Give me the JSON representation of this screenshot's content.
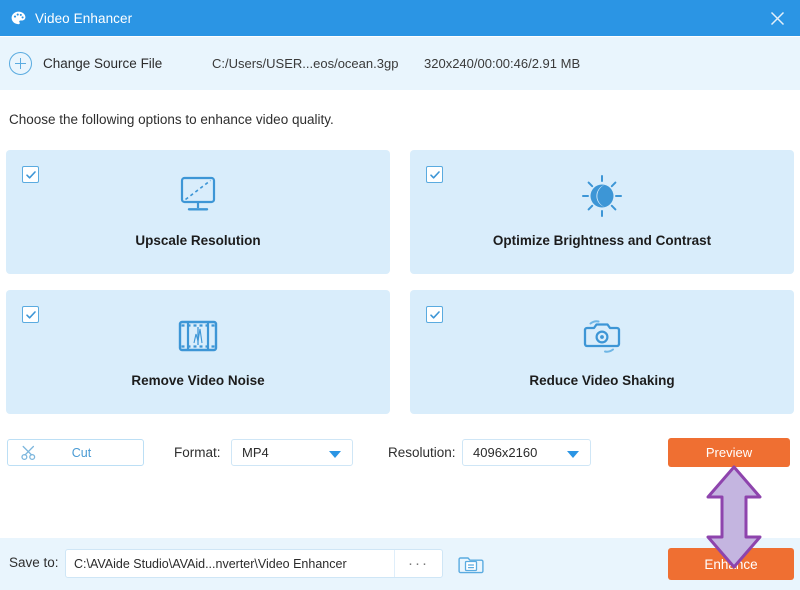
{
  "window": {
    "title": "Video Enhancer",
    "app_icon": "palette-icon",
    "close_icon": "close-icon",
    "titlebar_color": "#2b95e4"
  },
  "source_bar": {
    "add_icon": "plus-circle-icon",
    "change_source_label": "Change Source File",
    "file_path": "C:/Users/USER...eos/ocean.3gp",
    "file_meta": "320x240/00:00:46/2.91 MB"
  },
  "instruction": "Choose the following options to enhance video quality.",
  "options": [
    {
      "label": "Upscale Resolution",
      "icon": "monitor-icon",
      "checked": true
    },
    {
      "label": "Optimize Brightness and Contrast",
      "icon": "brightness-sun-icon",
      "checked": true
    },
    {
      "label": "Remove Video Noise",
      "icon": "film-strip-icon",
      "checked": true
    },
    {
      "label": "Reduce Video Shaking",
      "icon": "camera-icon",
      "checked": true
    }
  ],
  "controls": {
    "cut_label": "Cut",
    "cut_icon": "scissors-icon",
    "format_label": "Format:",
    "format_value": "MP4",
    "resolution_label": "Resolution:",
    "resolution_value": "4096x2160",
    "preview_label": "Preview",
    "dropdown_icon": "chevron-down-icon"
  },
  "footer": {
    "save_to_label": "Save to:",
    "save_to_path": "C:\\AVAide Studio\\AVAid...nverter\\Video Enhancer",
    "browse_label": "···",
    "folder_icon": "open-folder-icon",
    "enhance_label": "Enhance"
  },
  "annotation": {
    "icon": "double-arrow-up-down-icon",
    "fill": "#c4b5e0",
    "stroke": "#8e44ad"
  },
  "colors": {
    "accent_blue": "#2b95e4",
    "card_blue": "#d9edfb",
    "bar_blue": "#e9f5fd",
    "orange": "#ef6f32"
  }
}
